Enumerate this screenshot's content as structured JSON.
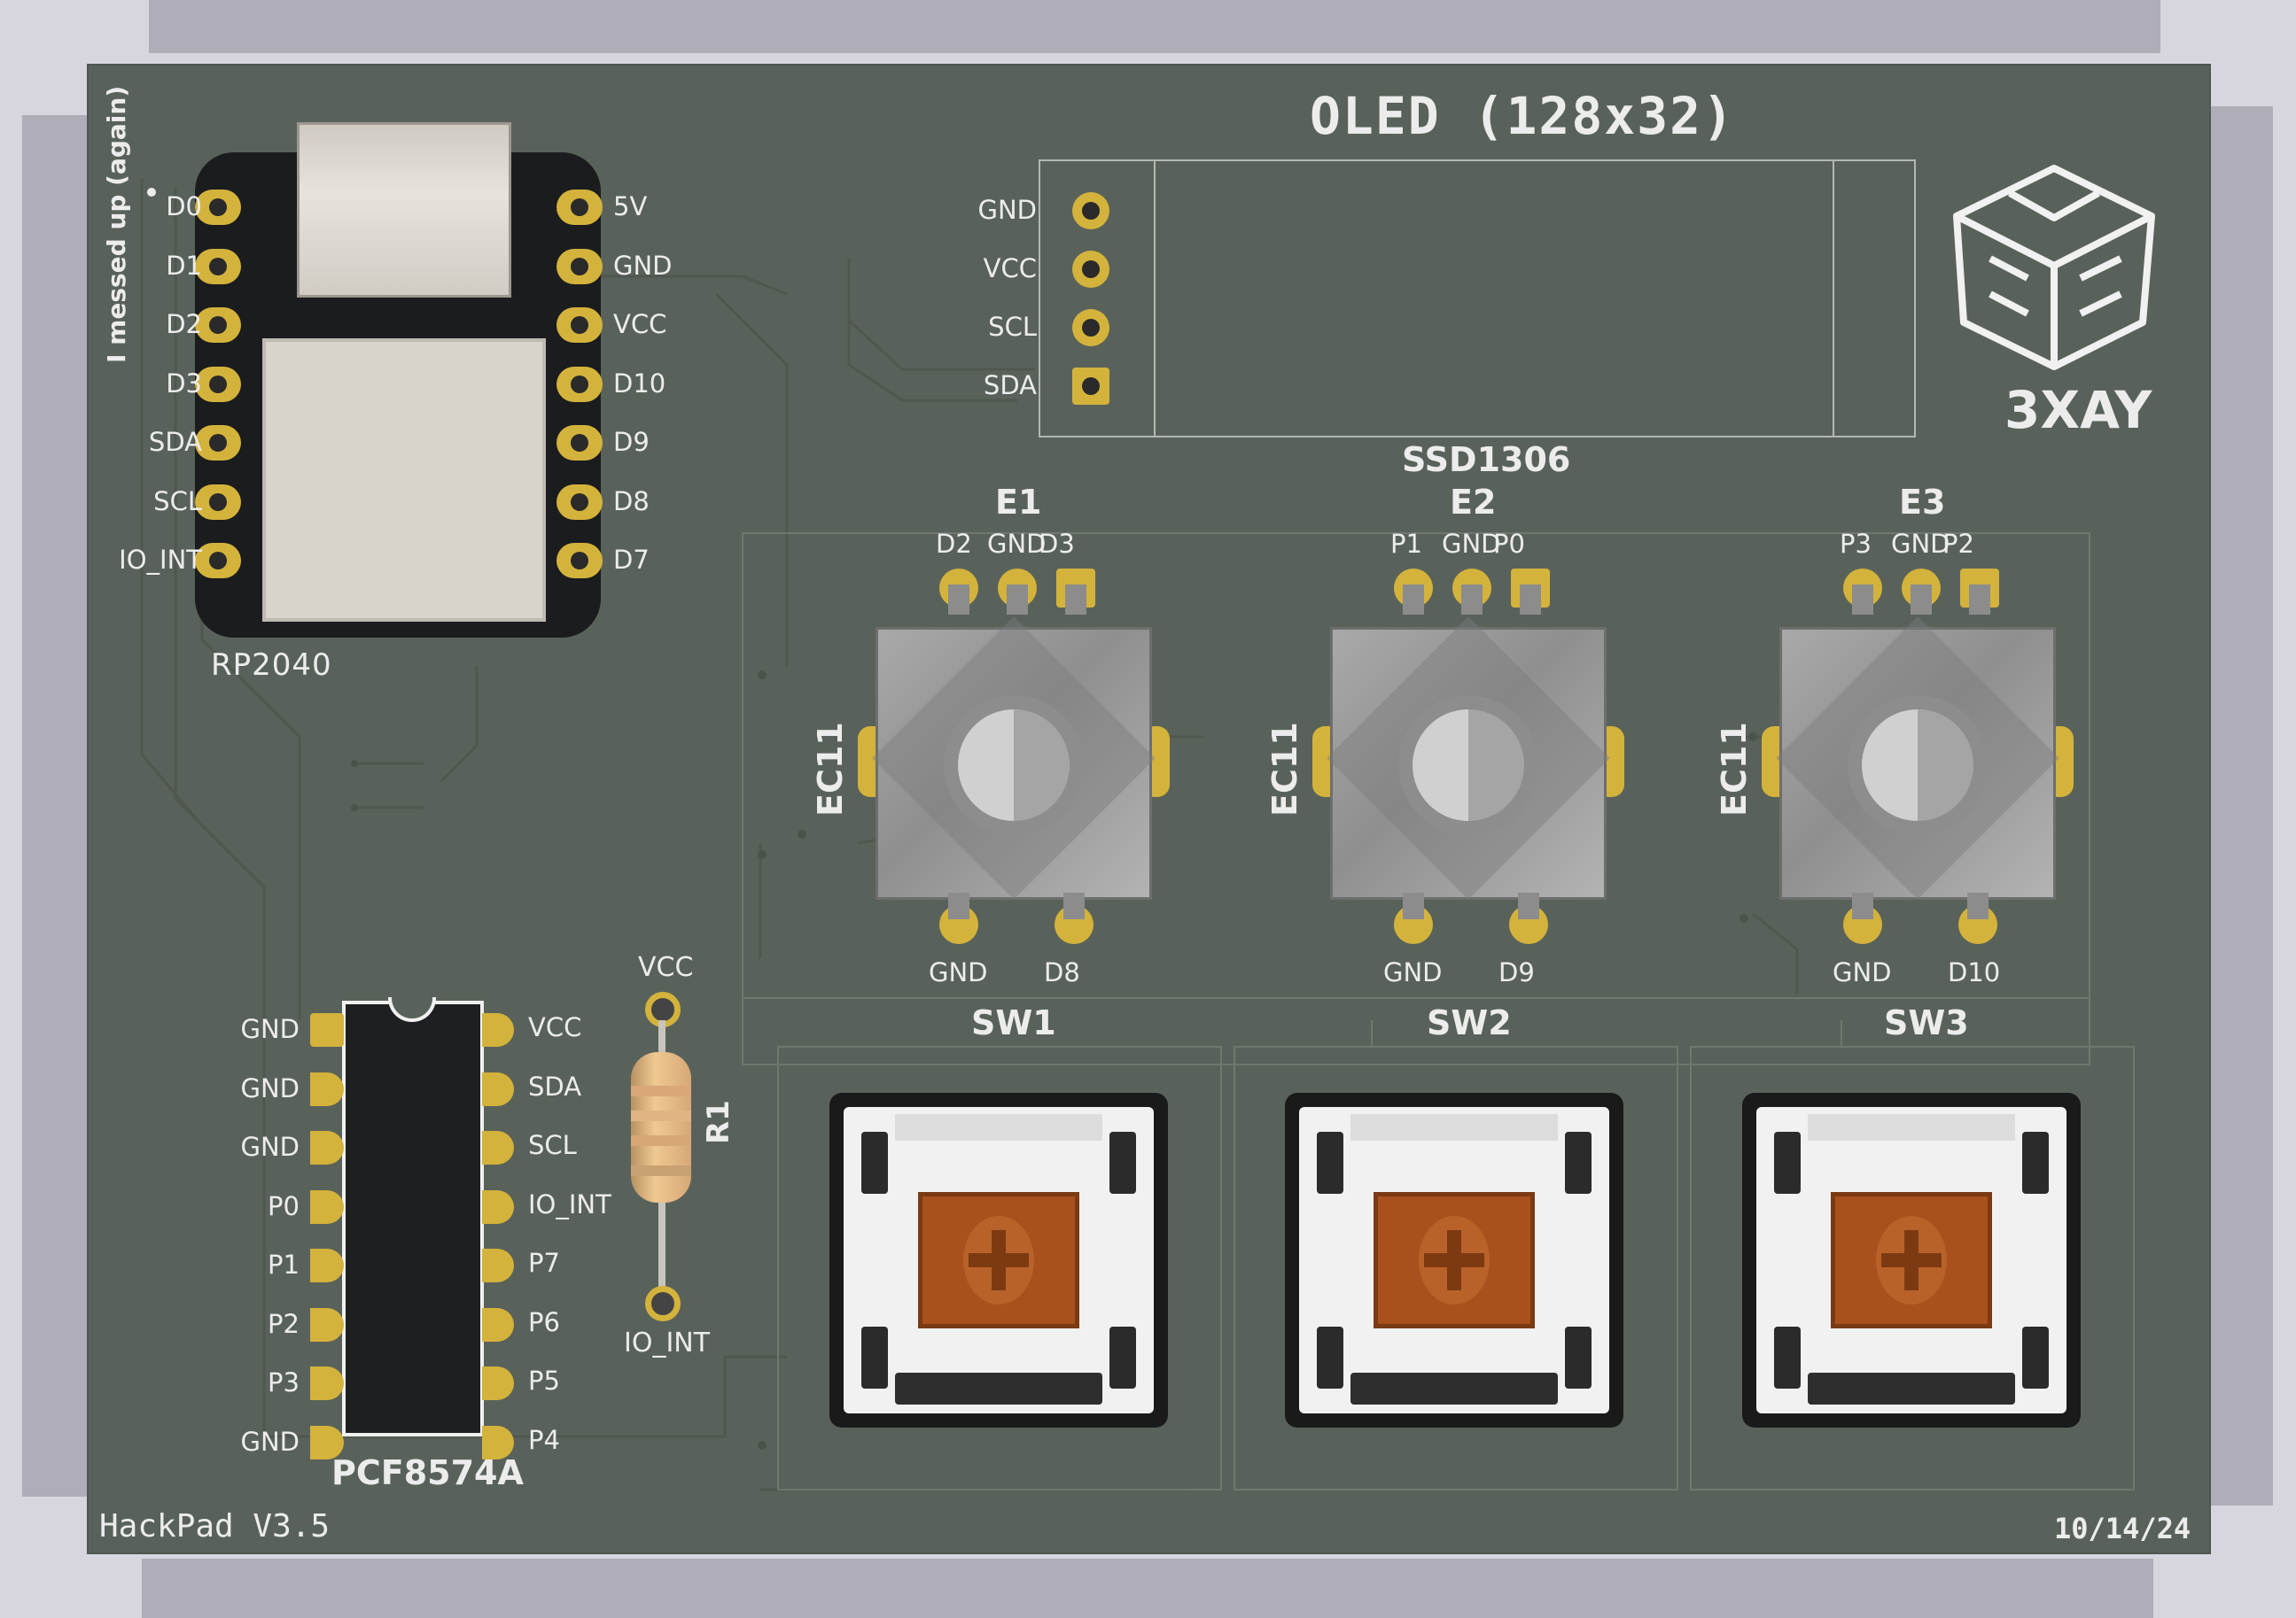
{
  "board": {
    "name": "HackPad V3.5",
    "date": "10/14/24",
    "note": "I messed up (again)",
    "logo_text": "3XAY"
  },
  "mcu": {
    "label": "RP2040",
    "left_pins": [
      "D0",
      "D1",
      "D2",
      "D3",
      "SDA",
      "SCL",
      "IO_INT"
    ],
    "right_pins": [
      "5V",
      "GND",
      "VCC",
      "D10",
      "D9",
      "D8",
      "D7"
    ]
  },
  "oled": {
    "title": "OLED (128x32)",
    "part": "SSD1306",
    "pins": [
      "GND",
      "VCC",
      "SCL",
      "SDA"
    ]
  },
  "encoders": [
    {
      "ref": "E1",
      "type": "EC11",
      "top_pins": [
        "D2",
        "GND",
        "D3"
      ],
      "bottom_pins": [
        "GND",
        "D8"
      ],
      "switch": "SW1"
    },
    {
      "ref": "E2",
      "type": "EC11",
      "top_pins": [
        "P1",
        "GND",
        "P0"
      ],
      "bottom_pins": [
        "GND",
        "D9"
      ],
      "switch": "SW2"
    },
    {
      "ref": "E3",
      "type": "EC11",
      "top_pins": [
        "P3",
        "GND",
        "P2"
      ],
      "bottom_pins": [
        "GND",
        "D10"
      ],
      "switch": "SW3"
    }
  ],
  "expander": {
    "part": "PCF8574A",
    "left_pins": [
      "GND",
      "GND",
      "GND",
      "P0",
      "P1",
      "P2",
      "P3",
      "GND"
    ],
    "right_pins": [
      "VCC",
      "SDA",
      "SCL",
      "IO_INT",
      "P7",
      "P6",
      "P5",
      "P4"
    ]
  },
  "resistor": {
    "ref": "R1",
    "top_net": "VCC",
    "bottom_net": "IO_INT"
  },
  "colors": {
    "board": "#59625a",
    "pad_gold": "#d4b33c",
    "silkscreen": "#ececec",
    "switch_stem": "#b5571f"
  }
}
